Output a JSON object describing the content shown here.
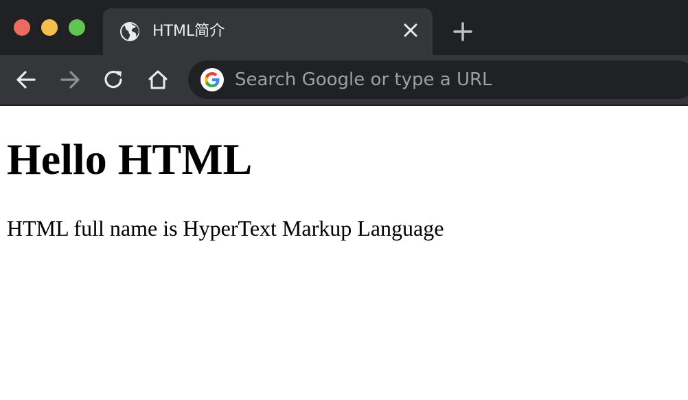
{
  "window": {
    "traffic_lights": {
      "close_color": "#ed6a5e",
      "minimize_color": "#f5bf4f",
      "maximize_color": "#61c554"
    }
  },
  "tabs": [
    {
      "title": "HTML简介",
      "favicon": "globe-icon",
      "active": true
    }
  ],
  "toolbar": {
    "icons": [
      "arrow-left-icon",
      "arrow-right-icon",
      "reload-icon",
      "home-icon"
    ],
    "forward_enabled": false
  },
  "omnibox": {
    "value": "",
    "placeholder": "Search Google or type a URL",
    "icon": "google-g-icon"
  },
  "page": {
    "heading": "Hello HTML",
    "paragraph": "HTML full name is HyperText Markup Language"
  },
  "colors": {
    "tabstrip_bg": "#202124",
    "toolbar_bg": "#35363a",
    "omnibox_bg": "#202124",
    "page_bg": "#ffffff"
  }
}
